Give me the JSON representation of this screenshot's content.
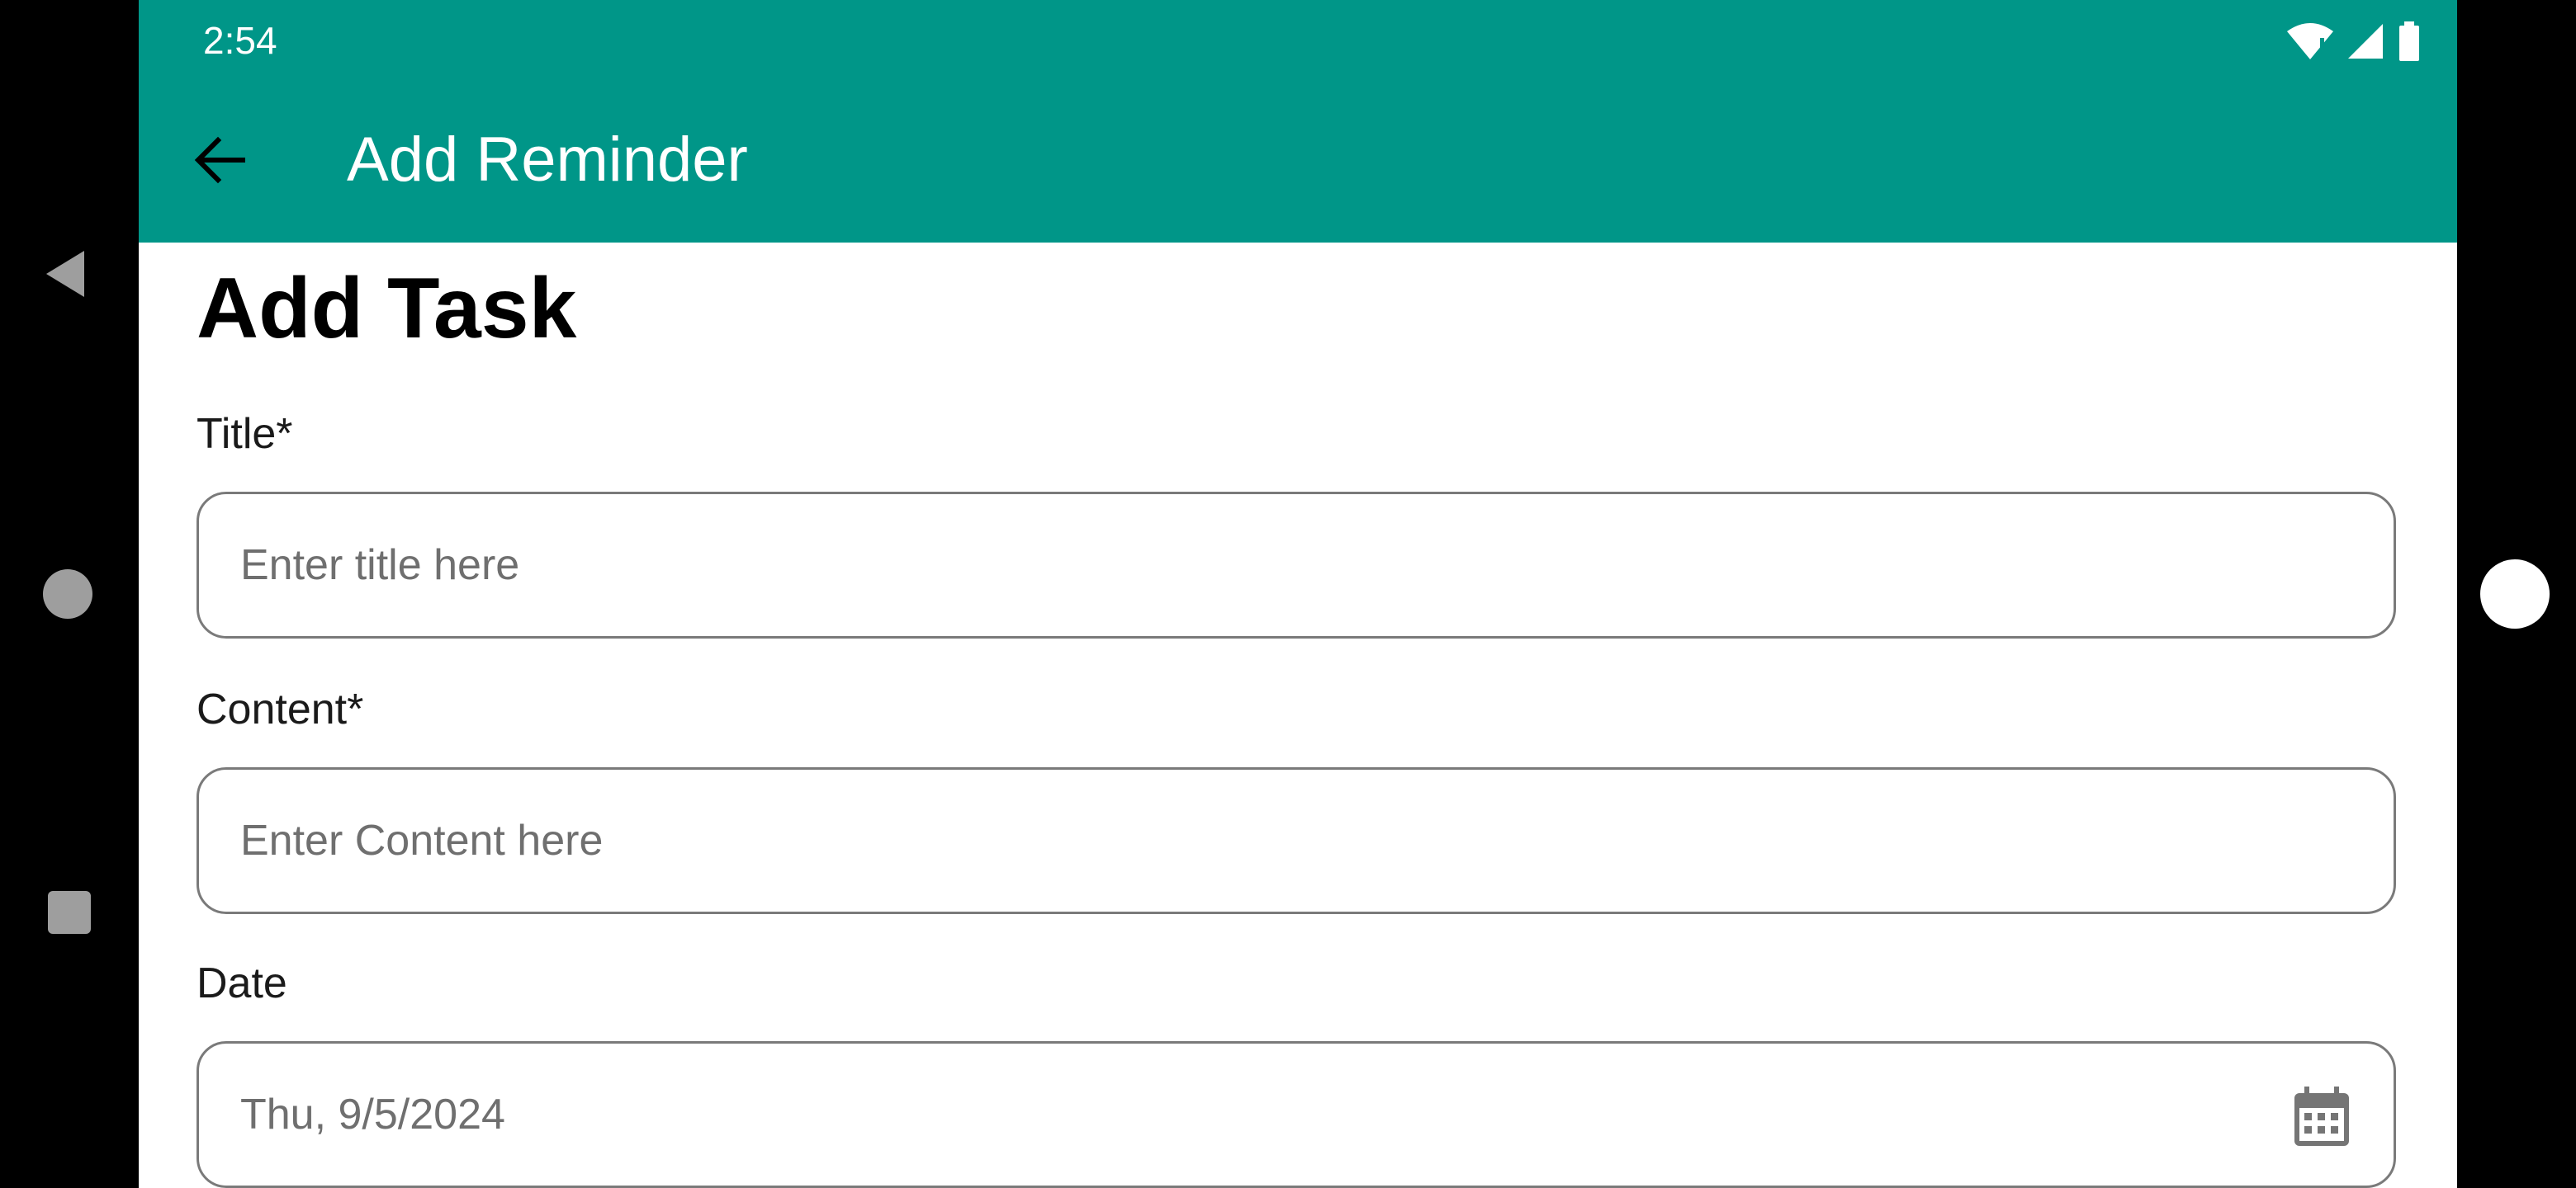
{
  "status_bar": {
    "time": "2:54",
    "icons": [
      "wifi-alert-icon",
      "cellular-signal-icon",
      "battery-icon"
    ]
  },
  "app_bar": {
    "title": "Add Reminder",
    "back_icon": "arrow-back-icon"
  },
  "form": {
    "heading": "Add Task",
    "title_field": {
      "label": "Title*",
      "placeholder": "Enter title here"
    },
    "content_field": {
      "label": "Content*",
      "placeholder": "Enter Content here"
    },
    "date_field": {
      "label": "Date",
      "value": "Thu, 9/5/2024",
      "icon": "calendar-icon"
    }
  },
  "colors": {
    "primary": "#009688",
    "on_primary": "#ffffff",
    "field_border": "#7a7a7a",
    "placeholder": "#6f6f6f"
  },
  "system_nav": {
    "buttons": [
      "back-triangle-icon",
      "home-circle-icon",
      "recents-square-icon"
    ]
  }
}
